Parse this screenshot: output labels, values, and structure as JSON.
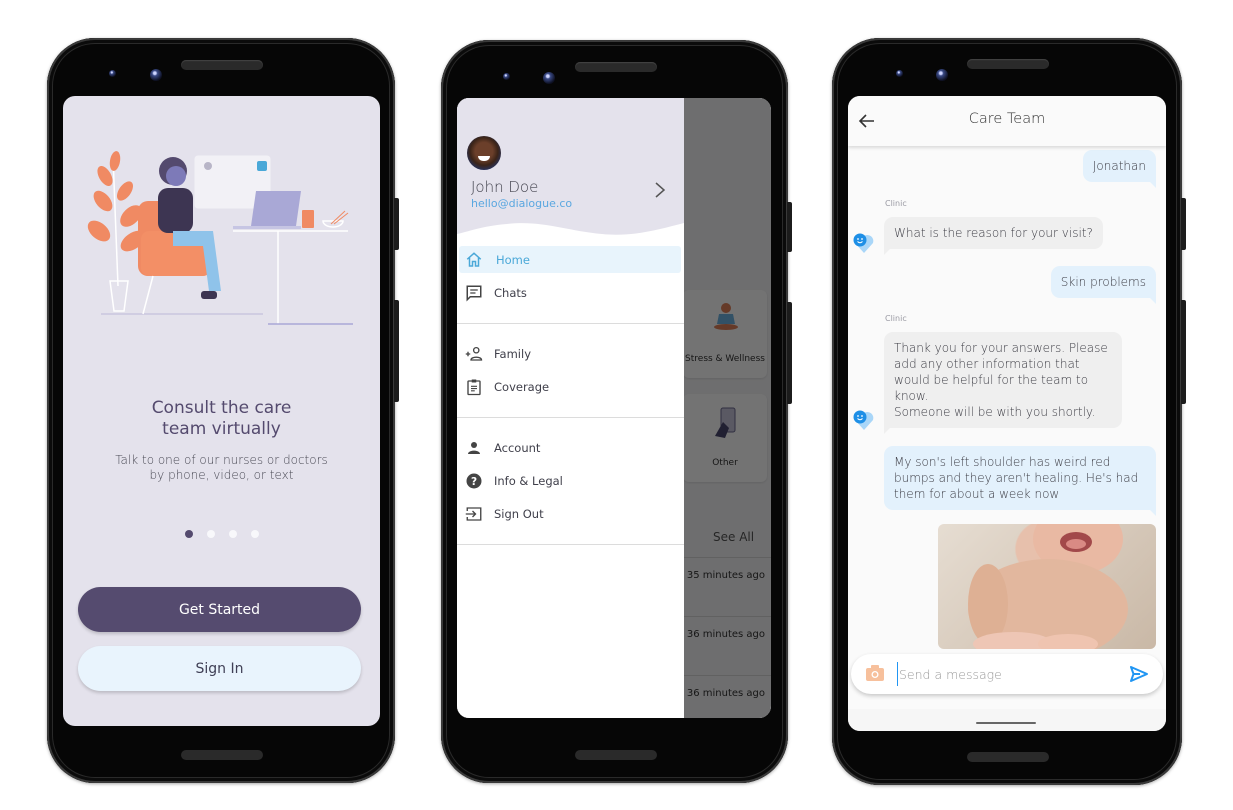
{
  "onboarding": {
    "title_line1": "Consult the care",
    "title_line2": "team virtually",
    "subtitle_line1": "Talk to one of our nurses or doctors",
    "subtitle_line2": "by phone, video, or text",
    "page_indicator": {
      "total": 4,
      "current": 1
    },
    "get_started_label": "Get Started",
    "sign_in_label": "Sign In",
    "colors": {
      "primary": "#554b6f",
      "secondary": "#e9f4fd",
      "background": "#e4e2ec",
      "accent": "#f08a63"
    }
  },
  "drawer": {
    "user": {
      "name": "John Doe",
      "email": "hello@dialogue.co"
    },
    "sections": [
      {
        "items": [
          {
            "label": "Home",
            "icon": "home-icon",
            "active": true
          },
          {
            "label": "Chats",
            "icon": "chat-icon",
            "active": false
          }
        ]
      },
      {
        "items": [
          {
            "label": "Family",
            "icon": "add-person-icon",
            "active": false
          },
          {
            "label": "Coverage",
            "icon": "clipboard-icon",
            "active": false
          }
        ]
      },
      {
        "items": [
          {
            "label": "Account",
            "icon": "person-icon",
            "active": false
          },
          {
            "label": "Info & Legal",
            "icon": "help-icon",
            "active": false
          },
          {
            "label": "Sign Out",
            "icon": "sign-out-icon",
            "active": false
          }
        ]
      }
    ],
    "background_screen": {
      "cards": [
        "Stress & Wellness",
        "Other"
      ],
      "see_all_label": "See All",
      "recent_times": [
        "35 minutes ago",
        "36 minutes ago",
        "36 minutes ago"
      ]
    },
    "colors": {
      "active_bg": "#e8f4fc",
      "active_text": "#4aa8d8",
      "email": "#5aa7e0"
    }
  },
  "chat": {
    "title": "Care Team",
    "messages": [
      {
        "from": "me",
        "text": "Jonathan"
      },
      {
        "from": "clinic",
        "sender": "Clinic",
        "text": "What is the reason for your visit?"
      },
      {
        "from": "me",
        "text": "Skin problems"
      },
      {
        "from": "clinic",
        "sender": "Clinic",
        "lines": [
          "Thank you for your answers. Please",
          "add any other information that",
          "would be helpful for the team to",
          "know.",
          "Someone will be with you shortly."
        ]
      },
      {
        "from": "me",
        "lines": [
          "My son's left shoulder has weird red",
          "bumps and they aren't healing. He's had",
          "them for about a week now"
        ]
      },
      {
        "from": "me",
        "type": "image",
        "alt": "Photo of baby's chest and shoulder"
      }
    ],
    "input": {
      "placeholder": "Send a message",
      "value": ""
    },
    "colors": {
      "my_bubble": "#e3f1fc",
      "clinic_bubble": "#efefef",
      "send": "#2196f3",
      "camera": "#f7c09c"
    }
  }
}
